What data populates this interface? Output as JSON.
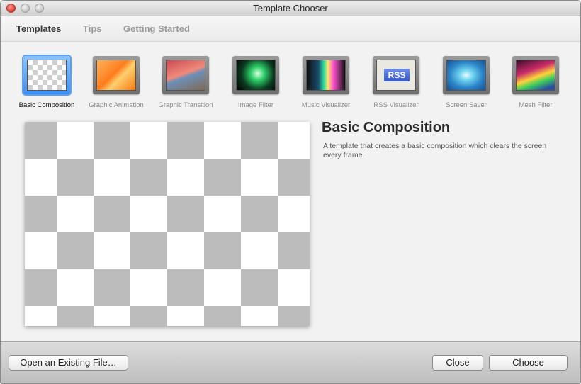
{
  "window": {
    "title": "Template Chooser"
  },
  "tabs": [
    {
      "label": "Templates",
      "active": true
    },
    {
      "label": "Tips",
      "active": false
    },
    {
      "label": "Getting Started",
      "active": false
    }
  ],
  "templates": [
    {
      "label": "Basic Composition",
      "selected": true
    },
    {
      "label": "Graphic Animation",
      "selected": false
    },
    {
      "label": "Graphic Transition",
      "selected": false
    },
    {
      "label": "Image Filter",
      "selected": false
    },
    {
      "label": "Music Visualizer",
      "selected": false
    },
    {
      "label": "RSS Visualizer",
      "selected": false
    },
    {
      "label": "Screen Saver",
      "selected": false
    },
    {
      "label": "Mesh Filter",
      "selected": false
    }
  ],
  "rss_thumb_text": "RSS",
  "detail": {
    "title": "Basic Composition",
    "description": "A template that creates a basic composition which clears the screen every frame."
  },
  "buttons": {
    "open_existing": "Open an Existing File…",
    "close": "Close",
    "choose": "Choose"
  }
}
